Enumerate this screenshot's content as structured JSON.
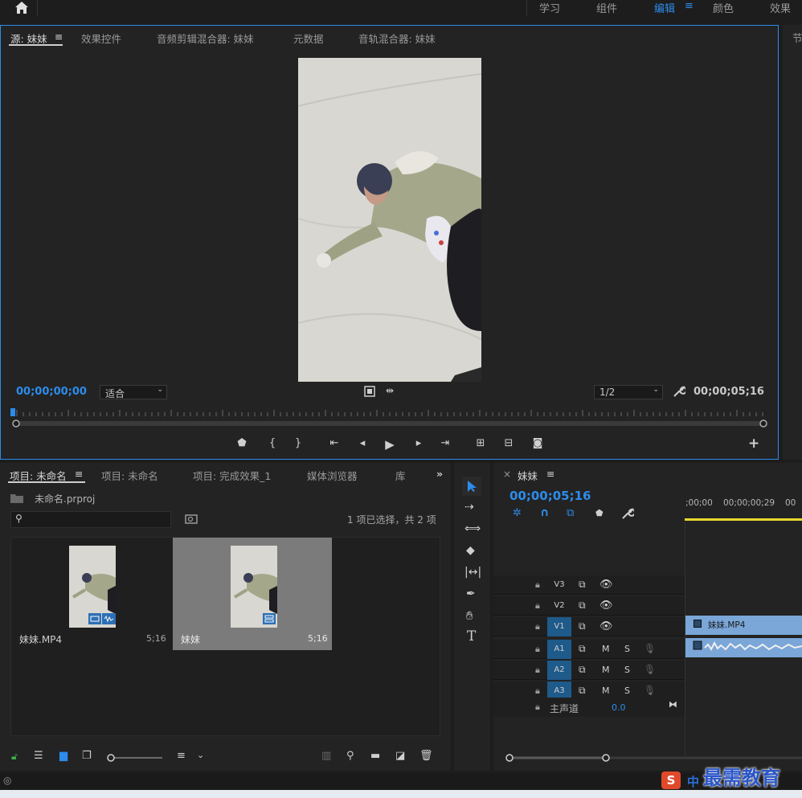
{
  "workspaces": {
    "items": [
      {
        "label": "学习"
      },
      {
        "label": "组件"
      },
      {
        "label": "编辑"
      },
      {
        "label": "颜色"
      },
      {
        "label": "效果"
      }
    ],
    "menu_icon": "≡"
  },
  "source": {
    "tabs": [
      {
        "label": "源: 妹妹"
      },
      {
        "label": "效果控件"
      },
      {
        "label": "音频剪辑混合器: 妹妹"
      },
      {
        "label": "元数据"
      },
      {
        "label": "音轨混合器: 妹妹"
      }
    ],
    "tab_menu_icon": "≡",
    "timecode_in": "00;00;00;00",
    "zoom_value": "适合",
    "resolution_value": "1/2",
    "timecode_duration": "00;00;05;16",
    "peek_label": "节"
  },
  "project": {
    "tabs": [
      {
        "label": "项目: 未命名"
      },
      {
        "label": "项目: 未命名"
      },
      {
        "label": "项目: 完成效果_1"
      },
      {
        "label": "媒体浏览器"
      },
      {
        "label": "库"
      }
    ],
    "tab_menu_icon": "≡",
    "overflow_icon": "»",
    "file_name": "未命名.prproj",
    "search_placeholder": "",
    "selection_status": "1 项已选择，共 2 项",
    "items": [
      {
        "name": "妹妹.MP4",
        "duration": "5;16"
      },
      {
        "name": "妹妹",
        "duration": "5;16"
      }
    ]
  },
  "timeline": {
    "close_icon": "×",
    "title": "妹妹",
    "menu_icon": "≡",
    "timecode": "00;00;05;16",
    "ruler_labels": [
      ";00;00",
      "00;00;00;29",
      "00"
    ],
    "tracks": [
      {
        "label": "V3",
        "type": "video",
        "on": false
      },
      {
        "label": "V2",
        "type": "video",
        "on": false
      },
      {
        "label": "V1",
        "type": "video",
        "on": true
      },
      {
        "label": "A1",
        "type": "audio",
        "on": true
      },
      {
        "label": "A2",
        "type": "audio",
        "on": true
      },
      {
        "label": "A3",
        "type": "audio",
        "on": true
      }
    ],
    "mute_label": "M",
    "solo_label": "S",
    "master_label": "主声道",
    "master_value": "0.0",
    "clip_label": "妹妹.MP4"
  },
  "watermark": {
    "brand": "最需教育",
    "ime_label": "中"
  },
  "colors": {
    "accent": "#2d8ceb",
    "track_on": "#1e5a8a",
    "clip": "#7aa6d8",
    "playhead_bar": "#e8d82c"
  }
}
